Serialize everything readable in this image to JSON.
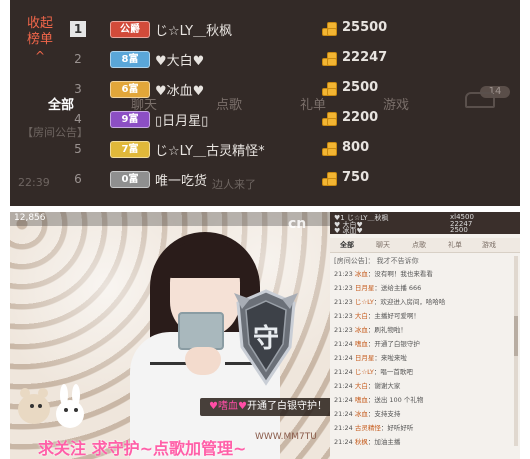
{
  "ranking_panel": {
    "collapse_label_1": "收起",
    "collapse_label_2": "榜单",
    "collapse_arrow": "^",
    "rows": [
      {
        "rank": "1",
        "badge": "公爵",
        "badge_color": "#d24b3a",
        "name": "じ☆LY＿秋枫",
        "score": "25500"
      },
      {
        "rank": "2",
        "badge": "8富",
        "badge_color": "#5aa6d8",
        "name": "♥大白♥",
        "score": "22247"
      },
      {
        "rank": "3",
        "badge": "6富",
        "badge_color": "#e2a63a",
        "name": "♥冰血♥",
        "score": "2500"
      },
      {
        "rank": "4",
        "badge": "9富",
        "badge_color": "#8c4fc4",
        "name": "▯日月星▯",
        "score": "2200"
      },
      {
        "rank": "5",
        "badge": "7富",
        "badge_color": "#e0b83a",
        "name": "じ☆LY＿古灵精怪*",
        "score": "800"
      },
      {
        "rank": "6",
        "badge": "0富",
        "badge_color": "#8f8f8f",
        "name": "唯一吃货",
        "score": "750"
      }
    ]
  },
  "ghost_background": {
    "tabs": [
      "全部",
      "聊天",
      "点歌",
      "礼单",
      "游戏"
    ],
    "badge_count": "14",
    "notice_prefix": "【房间公告】",
    "time_text": "22:39",
    "fragment_text": "边人来了"
  },
  "video": {
    "level_text": "12,856",
    "logo_text": "cn",
    "shield_glyph": "守",
    "notice_name": "♥嗜血♥",
    "notice_rest": "开通了白银守护！",
    "pink_caption": "求关注 求守护~点歌加管理~",
    "watermark": "WWW.MM7TU"
  },
  "side_chat": {
    "top_rows": [
      "♥1  じ☆LY＿秋枫",
      "♥ 大白♥",
      "♥ 冰血♥"
    ],
    "top_scores": [
      "xl4500",
      "22247",
      "2500"
    ],
    "tabs": [
      "全部",
      "聊天",
      "点歌",
      "礼单",
      "游戏"
    ],
    "notice": "[房间公告]：  我才不告诉你",
    "lines": [
      {
        "time": "21:23",
        "user": "冰血",
        "text": "：没有啊！我也来看看"
      },
      {
        "time": "21:23",
        "user": "日月星",
        "text": "：送给主播 666"
      },
      {
        "time": "21:23",
        "user": "じ☆LY",
        "text": "：欢迎进入房间，哈哈哈"
      },
      {
        "time": "21:23",
        "user": "大白",
        "text": "：主播好可爱啊！"
      },
      {
        "time": "21:23",
        "user": "冰血",
        "text": "：刷礼物啦！"
      },
      {
        "time": "21:24",
        "user": "嗜血",
        "text": "：开通了白银守护"
      },
      {
        "time": "21:24",
        "user": "日月星",
        "text": "：来啦来啦"
      },
      {
        "time": "21:24",
        "user": "じ☆LY",
        "text": "：唱一首歌吧"
      },
      {
        "time": "21:24",
        "user": "大白",
        "text": "：谢谢大家"
      },
      {
        "time": "21:24",
        "user": "嗜血",
        "text": "：送出 100 个礼物"
      },
      {
        "time": "21:24",
        "user": "冰血",
        "text": "：支持支持"
      },
      {
        "time": "21:24",
        "user": "古灵精怪",
        "text": "：好听好听"
      },
      {
        "time": "21:24",
        "user": "秋枫",
        "text": "：加油主播"
      }
    ]
  },
  "colors": {
    "panel_bg": "#332a27",
    "accent_red": "#f0664a",
    "coin": "#f2b533",
    "pink": "#ff5fa8"
  }
}
